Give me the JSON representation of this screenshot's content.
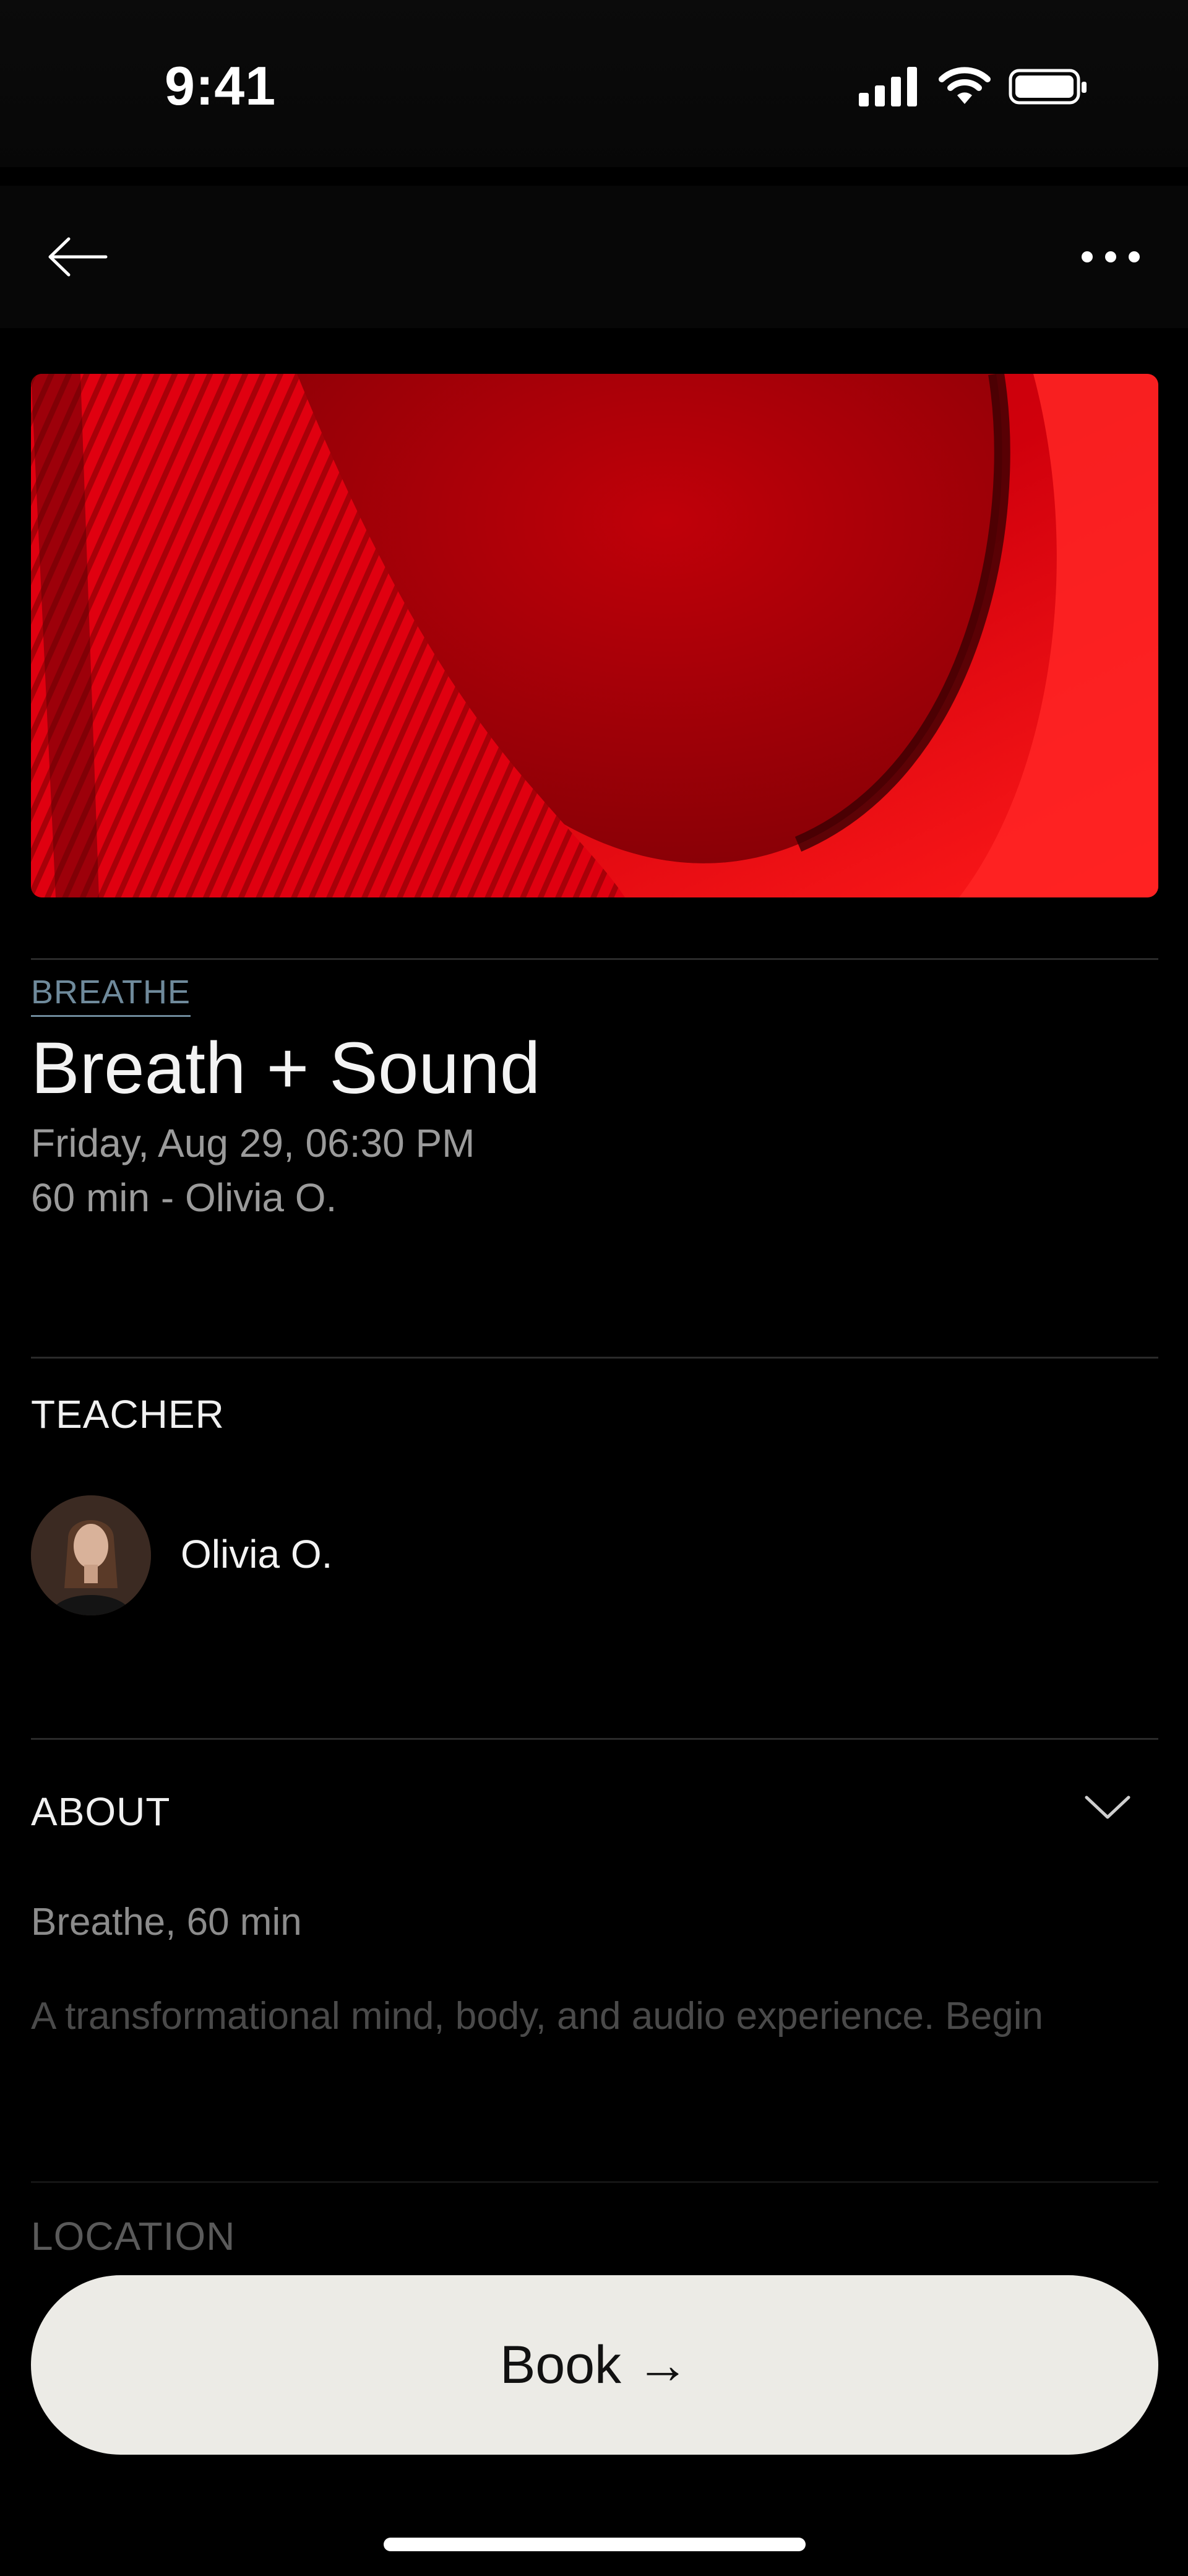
{
  "status_bar": {
    "time": "9:41"
  },
  "nav": {
    "back_icon": "arrow-left-icon",
    "more_icon": "ellipsis-icon"
  },
  "class": {
    "category": "BREATHE",
    "title": "Breath + Sound",
    "datetime": "Friday, Aug 29, 06:30 PM",
    "duration_teacher": "60 min - Olivia O."
  },
  "teacher": {
    "label": "TEACHER",
    "name": "Olivia O."
  },
  "about": {
    "label": "ABOUT",
    "subtitle": "Breathe, 60 min",
    "description": "A transformational mind, body, and audio experience. Begin"
  },
  "location": {
    "label": "LOCATION"
  },
  "book_button": {
    "label": "Book →"
  },
  "colors": {
    "accent": "#6f8a9b",
    "hero_red": "#e0000d",
    "button_bg": "#ecebe6"
  }
}
